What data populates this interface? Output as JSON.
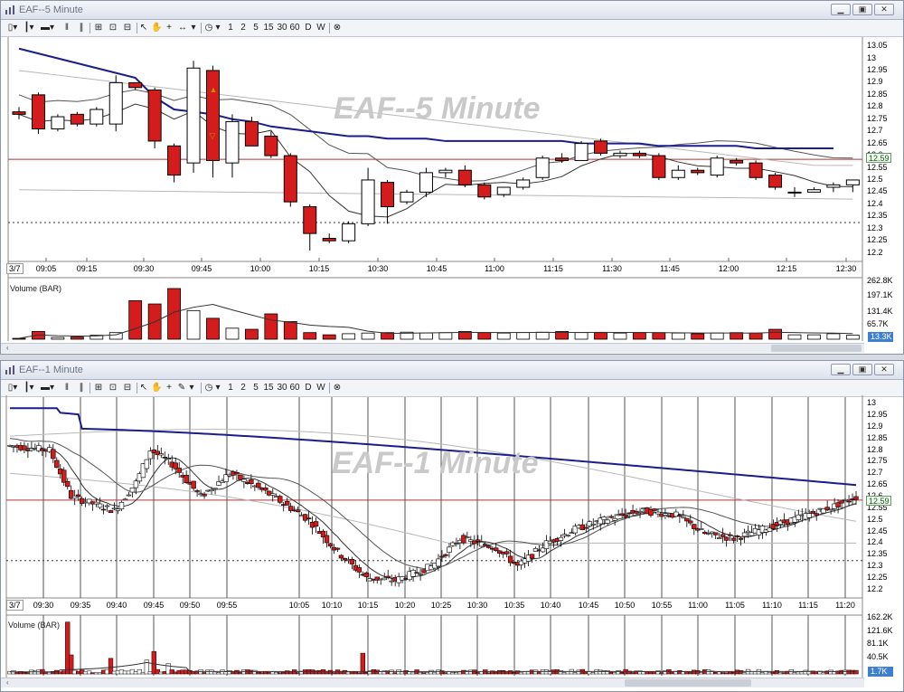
{
  "windows": [
    {
      "title": "EAF--5 Minute",
      "watermark": "EAF--5 Minute",
      "date_tag": "3/7",
      "volume_label": "Volume (BAR)",
      "last_price": "12.59",
      "last_volume": "13.3K",
      "price_ticks": [
        "13.05",
        "13",
        "12.95",
        "12.9",
        "12.85",
        "12.8",
        "12.75",
        "12.7",
        "12.65",
        "12.6",
        "12.55",
        "12.5",
        "12.45",
        "12.4",
        "12.35",
        "12.3",
        "12.25",
        "12.2"
      ],
      "volume_ticks": [
        "262.8K",
        "197.1K",
        "131.4K",
        "65.7K"
      ],
      "time_ticks": [
        "09:05",
        "09:15",
        "09:30",
        "09:45",
        "10:00",
        "10:15",
        "10:30",
        "10:45",
        "11:00",
        "11:15",
        "11:30",
        "11:45",
        "12:00",
        "12:15",
        "12:30"
      ],
      "toolbar_nums": [
        "1",
        "2",
        "5",
        "15",
        "30",
        "60",
        "D",
        "W"
      ]
    },
    {
      "title": "EAF--1 Minute",
      "watermark": "EAF--1 Minute",
      "date_tag": "3/7",
      "volume_label": "Volume (BAR)",
      "last_price": "12.59",
      "last_volume": "1.7K",
      "price_ticks": [
        "13",
        "12.95",
        "12.9",
        "12.85",
        "12.8",
        "12.75",
        "12.7",
        "12.65",
        "12.6",
        "12.55",
        "12.5",
        "12.45",
        "12.4",
        "12.35",
        "12.3",
        "12.25",
        "12.2"
      ],
      "volume_ticks": [
        "162.2K",
        "121.6K",
        "81.1K",
        "40.5K"
      ],
      "time_ticks": [
        "09:30",
        "09:35",
        "09:40",
        "09:45",
        "09:50",
        "09:55",
        "10:05",
        "10:10",
        "10:15",
        "10:20",
        "10:25",
        "10:30",
        "10:35",
        "10:40",
        "10:45",
        "10:50",
        "10:55",
        "11:00",
        "11:05",
        "11:10",
        "11:15",
        "11:20"
      ],
      "toolbar_nums": [
        "1",
        "2",
        "5",
        "15",
        "30",
        "60",
        "D",
        "W"
      ]
    }
  ],
  "colors": {
    "up": "#ffffff",
    "down": "#d41c1c",
    "vwap": "#1c1c8c",
    "band": "#b8b8b8",
    "ref_line": "#b83030",
    "ma": "#333333"
  },
  "icons": [
    "chart-icon",
    "bar-style-icon",
    "crosshair-icon",
    "zoom-icon",
    "hand-icon",
    "arrow-icon",
    "clock-icon",
    "close-circle-icon"
  ],
  "chart_data": [
    {
      "type": "candlestick",
      "title": "EAF--5 Minute",
      "x": [
        "09:00",
        "09:05",
        "09:10",
        "09:15",
        "09:20",
        "09:25",
        "09:30",
        "09:35",
        "09:40",
        "09:45",
        "09:50",
        "09:55",
        "10:00",
        "10:05",
        "10:10",
        "10:15",
        "10:20",
        "10:25",
        "10:30",
        "10:35",
        "10:40",
        "10:45",
        "10:50",
        "10:55",
        "11:00",
        "11:05",
        "11:10",
        "11:15",
        "11:20",
        "11:25",
        "11:30",
        "11:35",
        "11:40",
        "11:45",
        "11:50",
        "11:55",
        "12:00",
        "12:05",
        "12:10",
        "12:15",
        "12:20",
        "12:25",
        "12:30"
      ],
      "ohlc": [
        [
          12.78,
          12.8,
          12.75,
          12.77
        ],
        [
          12.85,
          12.86,
          12.69,
          12.71
        ],
        [
          12.71,
          12.77,
          12.7,
          12.76
        ],
        [
          12.77,
          12.78,
          12.72,
          12.73
        ],
        [
          12.73,
          12.8,
          12.72,
          12.79
        ],
        [
          12.73,
          12.93,
          12.7,
          12.9
        ],
        [
          12.9,
          12.9,
          12.87,
          12.88
        ],
        [
          12.87,
          12.88,
          12.63,
          12.66
        ],
        [
          12.64,
          12.65,
          12.49,
          12.52
        ],
        [
          12.57,
          12.99,
          12.53,
          12.96
        ],
        [
          12.95,
          12.97,
          12.51,
          12.58
        ],
        [
          12.57,
          12.77,
          12.51,
          12.74
        ],
        [
          12.74,
          12.76,
          12.66,
          12.64
        ],
        [
          12.68,
          12.7,
          12.59,
          12.6
        ],
        [
          12.6,
          12.61,
          12.39,
          12.41
        ],
        [
          12.39,
          12.4,
          12.21,
          12.28
        ],
        [
          12.26,
          12.28,
          12.24,
          12.25
        ],
        [
          12.25,
          12.33,
          12.24,
          12.32
        ],
        [
          12.32,
          12.55,
          12.31,
          12.5
        ],
        [
          12.49,
          12.5,
          12.32,
          12.39
        ],
        [
          12.41,
          12.46,
          12.4,
          12.45
        ],
        [
          12.45,
          12.55,
          12.43,
          12.53
        ],
        [
          12.53,
          12.55,
          12.51,
          12.54
        ],
        [
          12.54,
          12.56,
          12.47,
          12.48
        ],
        [
          12.48,
          12.49,
          12.42,
          12.43
        ],
        [
          12.44,
          12.47,
          12.43,
          12.47
        ],
        [
          12.47,
          12.51,
          12.46,
          12.5
        ],
        [
          12.51,
          12.6,
          12.5,
          12.59
        ],
        [
          12.59,
          12.61,
          12.57,
          12.58
        ],
        [
          12.58,
          12.66,
          12.58,
          12.65
        ],
        [
          12.66,
          12.67,
          12.6,
          12.61
        ],
        [
          12.6,
          12.62,
          12.59,
          12.61
        ],
        [
          12.61,
          12.62,
          12.59,
          12.6
        ],
        [
          12.6,
          12.61,
          12.5,
          12.51
        ],
        [
          12.51,
          12.56,
          12.5,
          12.54
        ],
        [
          12.54,
          12.55,
          12.52,
          12.53
        ],
        [
          12.52,
          12.6,
          12.51,
          12.59
        ],
        [
          12.58,
          12.59,
          12.56,
          12.57
        ],
        [
          12.57,
          12.58,
          12.5,
          12.51
        ],
        [
          12.52,
          12.53,
          12.46,
          12.47
        ],
        [
          12.45,
          12.47,
          12.43,
          12.45
        ],
        [
          12.45,
          12.47,
          12.45,
          12.46
        ],
        [
          12.47,
          12.49,
          12.45,
          12.48
        ],
        [
          12.48,
          12.5,
          12.45,
          12.5
        ]
      ],
      "volume": [
        4,
        35,
        8,
        10,
        18,
        30,
        175,
        160,
        230,
        130,
        95,
        50,
        45,
        115,
        80,
        30,
        20,
        25,
        28,
        30,
        32,
        28,
        30,
        35,
        30,
        28,
        30,
        32,
        35,
        30,
        30,
        28,
        30,
        30,
        28,
        25,
        28,
        30,
        28,
        45,
        20,
        20,
        25,
        18
      ],
      "vwap": [
        13.04,
        13.02,
        13.0,
        12.98,
        12.96,
        12.94,
        12.92,
        12.84,
        12.79,
        12.78,
        12.77,
        12.75,
        12.74,
        12.72,
        12.71,
        12.7,
        12.69,
        12.68,
        12.68,
        12.67,
        12.67,
        12.67,
        12.66,
        12.66,
        12.66,
        12.66,
        12.66,
        12.66,
        12.66,
        12.65,
        12.65,
        12.65,
        12.65,
        12.64,
        12.64,
        12.64,
        12.64,
        12.64,
        12.63,
        12.63,
        12.63,
        12.63,
        12.63
      ],
      "ylim": [
        12.18,
        13.08
      ]
    },
    {
      "type": "candlestick",
      "title": "EAF--1 Minute",
      "x_range": [
        "09:26",
        "11:22"
      ],
      "vwap_start": 12.98,
      "vwap_end": 12.65,
      "ylim": [
        12.18,
        13.02
      ]
    }
  ]
}
